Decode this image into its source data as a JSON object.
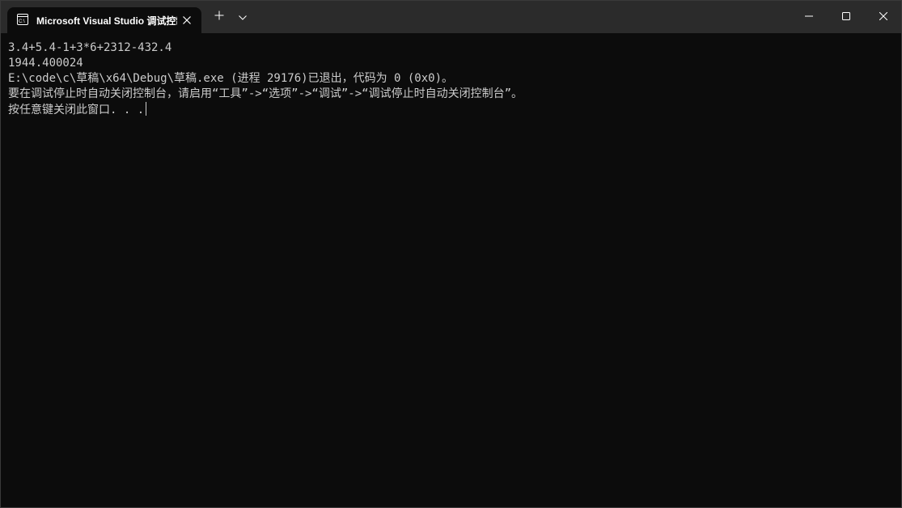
{
  "window": {
    "tab_title": "Microsoft Visual Studio 调试控制台",
    "tab_icon": "console-icon",
    "buttons": {
      "new_tab": "plus-icon",
      "dropdown": "chevron-down-icon",
      "minimize": "minimize-icon",
      "maximize": "maximize-icon",
      "close": "close-icon"
    }
  },
  "console": {
    "lines": [
      "3.4+5.4-1+3*6+2312-432.4",
      "1944.400024",
      "E:\\code\\c\\草稿\\x64\\Debug\\草稿.exe (进程 29176)已退出，代码为 0 (0x0)。",
      "要在调试停止时自动关闭控制台，请启用“工具”->“选项”->“调试”->“调试停止时自动关闭控制台”。",
      "按任意键关闭此窗口. . ."
    ]
  },
  "colors": {
    "background": "#0c0c0c",
    "titlebar": "#2b2b2b",
    "text": "#cccccc"
  }
}
